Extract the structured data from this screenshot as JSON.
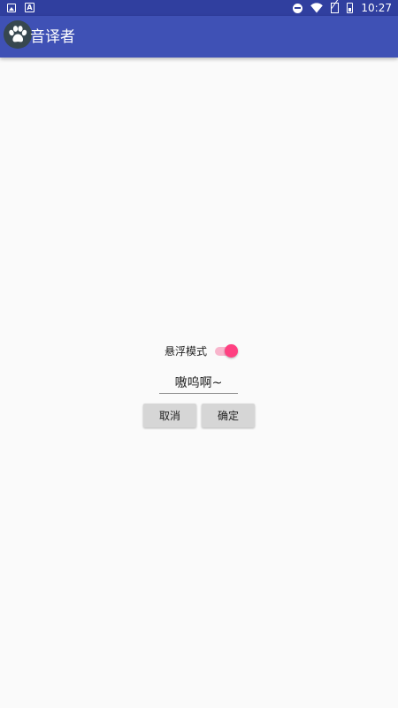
{
  "status_bar": {
    "time": "10:27",
    "notification_icons": [
      "image-icon",
      "font-icon"
    ],
    "system_icons": [
      "do-not-disturb-icon",
      "wifi-icon",
      "no-sim-icon",
      "battery-icon"
    ]
  },
  "app_bar": {
    "title": "音译者",
    "logo_icon": "paw-icon",
    "color": "#3f51b5",
    "status_color": "#303f9f"
  },
  "main": {
    "float_mode_label": "悬浮模式",
    "float_mode_enabled": true,
    "input_value": "嗷呜啊~",
    "cancel_label": "取消",
    "ok_label": "确定",
    "accent_color": "#ff4081"
  }
}
